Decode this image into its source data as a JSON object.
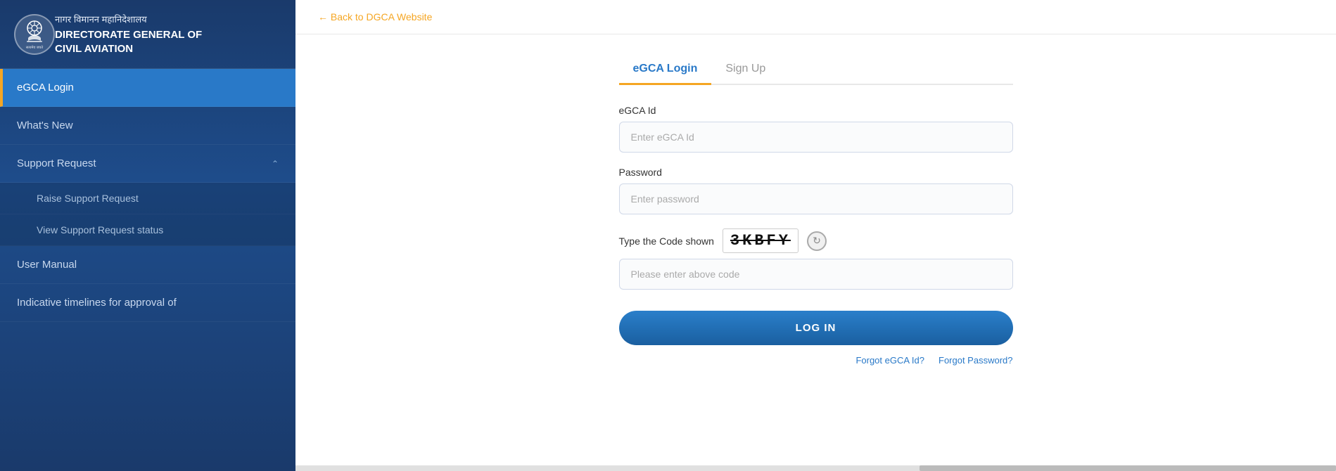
{
  "sidebar": {
    "org_hindi": "नागर विमानन महानिदेशालय",
    "org_name_line1": "DIRECTORATE GENERAL OF",
    "org_name_line2": "CIVIL AVIATION",
    "nav_items": [
      {
        "id": "egca-login",
        "label": "eGCA Login",
        "active": true,
        "has_children": false
      },
      {
        "id": "whats-new",
        "label": "What's New",
        "active": false,
        "has_children": false
      },
      {
        "id": "support-request",
        "label": "Support Request",
        "active": false,
        "has_children": true,
        "expanded": true
      },
      {
        "id": "user-manual",
        "label": "User Manual",
        "active": false,
        "has_children": false
      },
      {
        "id": "indicative-timelines",
        "label": "Indicative timelines for approval of",
        "active": false,
        "has_children": false
      }
    ],
    "sub_items": [
      {
        "id": "raise-support",
        "label": "Raise Support Request"
      },
      {
        "id": "view-support",
        "label": "View Support Request status"
      }
    ]
  },
  "header": {
    "back_label": "← Back to DGCA Website"
  },
  "tabs": [
    {
      "id": "egca-login-tab",
      "label": "eGCA Login",
      "active": true
    },
    {
      "id": "sign-up-tab",
      "label": "Sign Up",
      "active": false
    }
  ],
  "form": {
    "egca_id_label": "eGCA Id",
    "egca_id_placeholder": "Enter eGCA Id",
    "password_label": "Password",
    "password_placeholder": "Enter password",
    "captcha_label": "Type the Code shown",
    "captcha_value": "3KBFY",
    "captcha_input_placeholder": "Please enter above code",
    "login_button_label": "LOG IN",
    "forgot_egca_label": "Forgot eGCA Id?",
    "forgot_password_label": "Forgot Password?"
  },
  "colors": {
    "accent_orange": "#f5a623",
    "accent_blue": "#2979c8",
    "sidebar_bg": "#1a3a6b",
    "active_nav": "#2979c8"
  }
}
